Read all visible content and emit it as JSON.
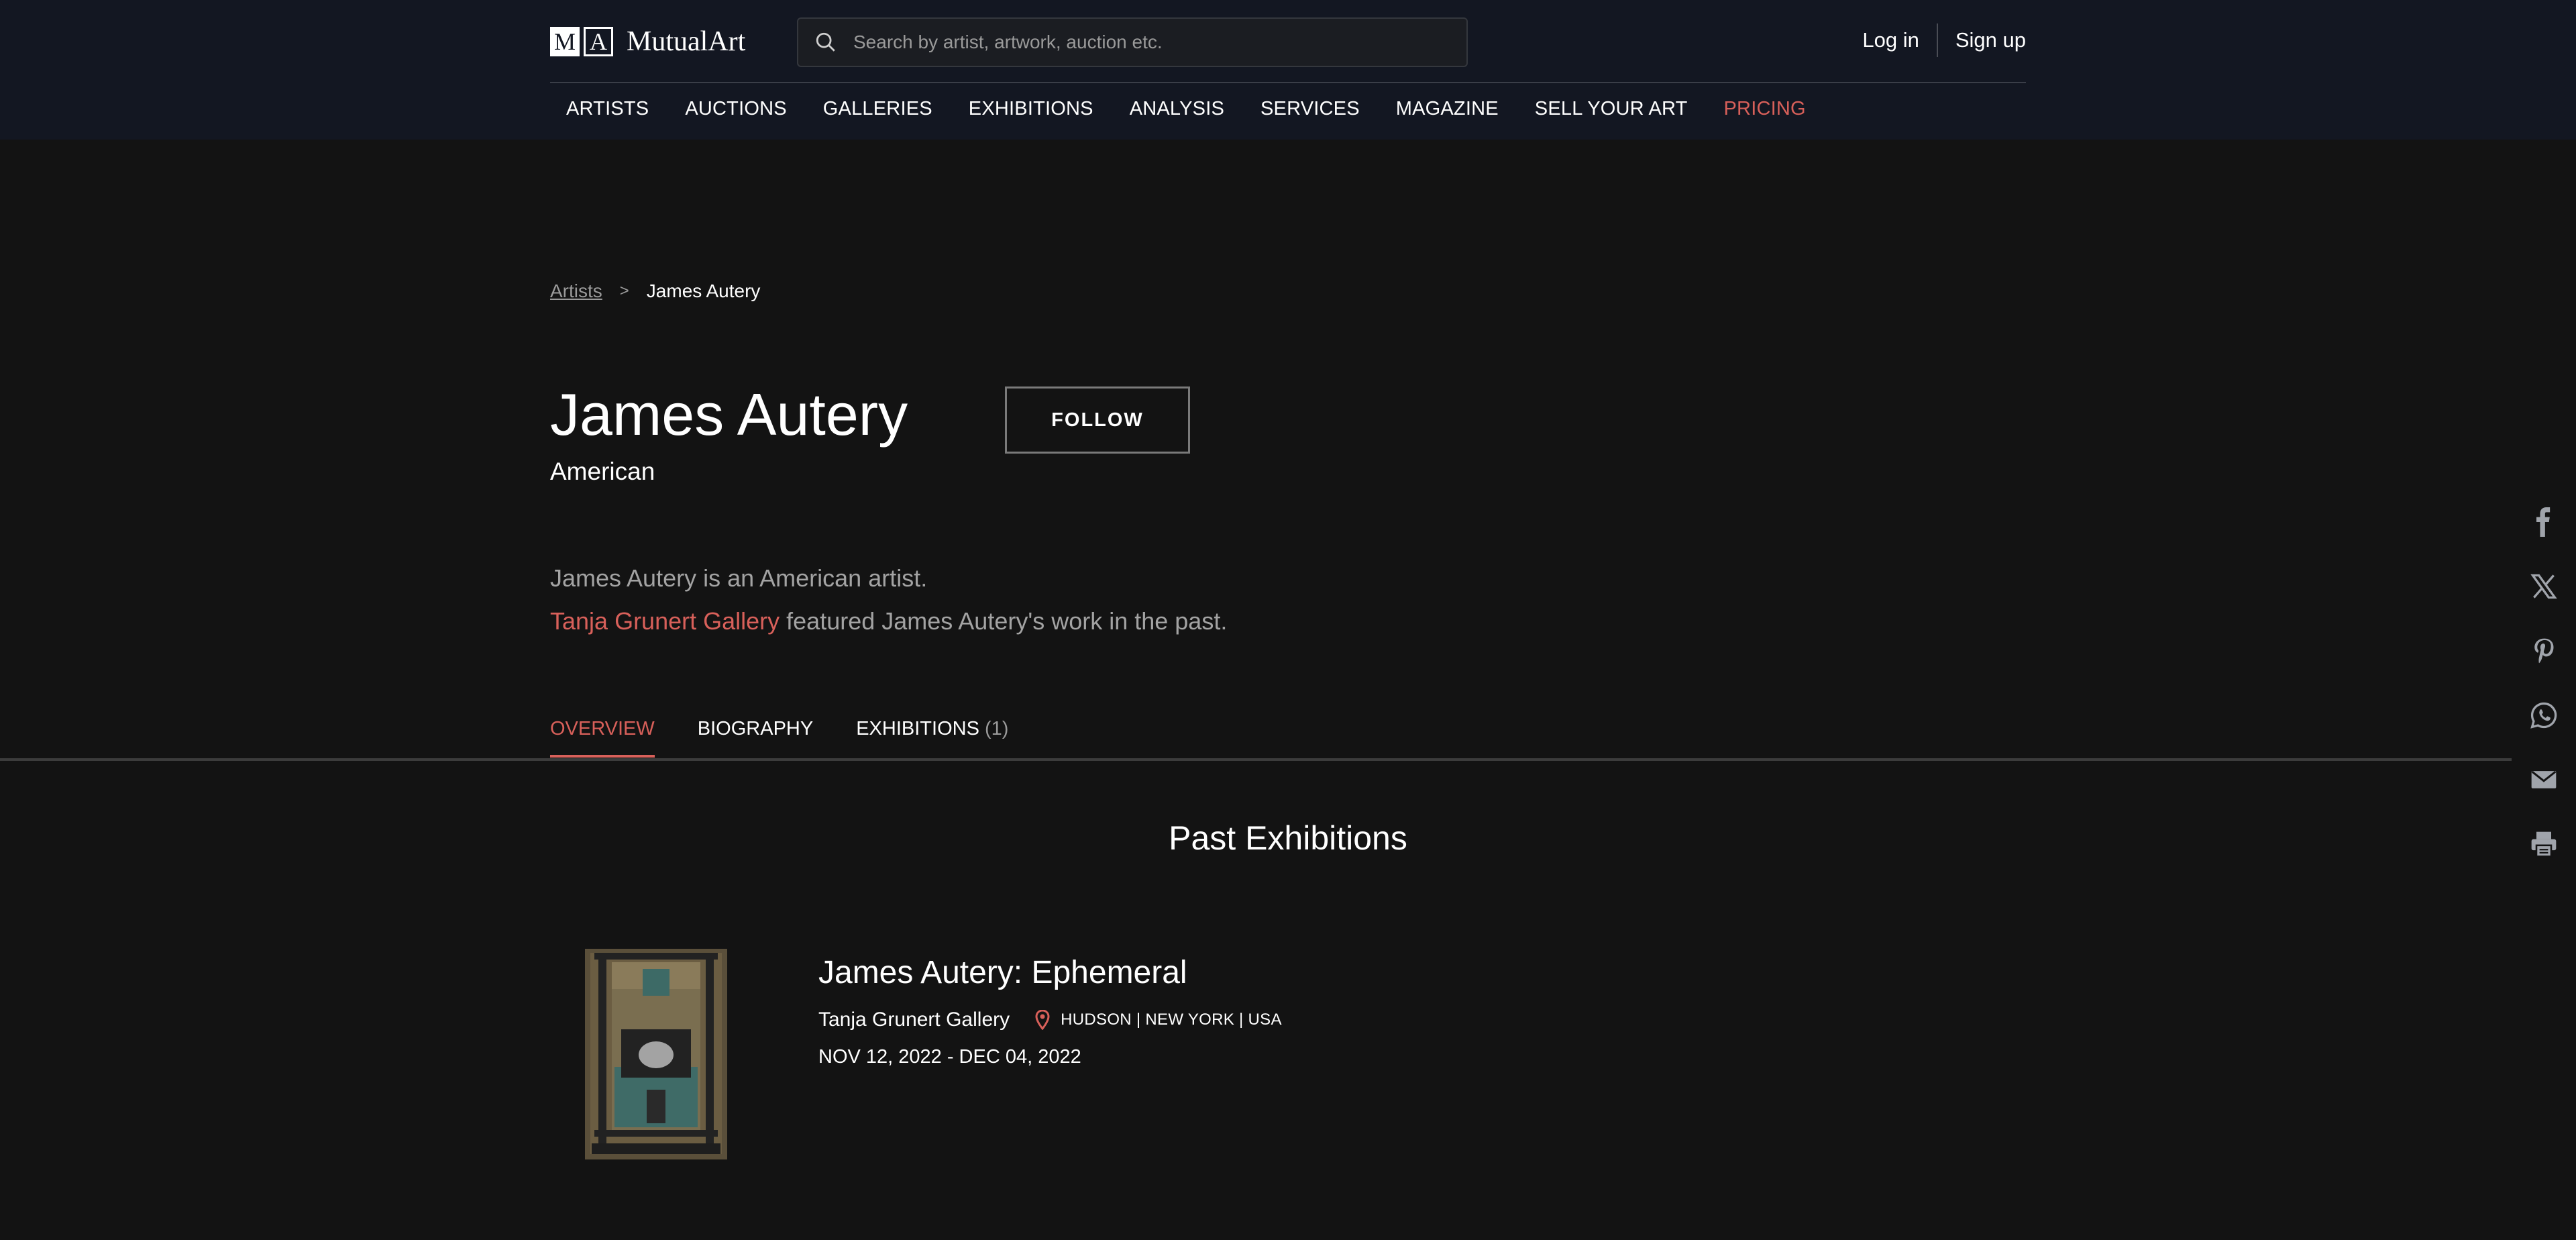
{
  "brand": {
    "logo_m": "M",
    "logo_a": "A",
    "name": "MutualArt"
  },
  "search": {
    "placeholder": "Search by artist, artwork, auction etc."
  },
  "auth": {
    "login": "Log in",
    "signup": "Sign up"
  },
  "nav": {
    "items": [
      "ARTISTS",
      "AUCTIONS",
      "GALLERIES",
      "EXHIBITIONS",
      "ANALYSIS",
      "SERVICES",
      "MAGAZINE",
      "SELL YOUR ART",
      "PRICING"
    ]
  },
  "breadcrumb": {
    "parent": "Artists",
    "separator": ">",
    "current": "James Autery"
  },
  "artist": {
    "name": "James Autery",
    "nationality": "American",
    "follow_label": "FOLLOW",
    "bio_line1": "James Autery is an American artist.",
    "bio_gallery": "Tanja Grunert Gallery",
    "bio_line2_rest": " featured James Autery's work in the past."
  },
  "tabs": {
    "overview": "OVERVIEW",
    "biography": "BIOGRAPHY",
    "exhibitions": "EXHIBITIONS",
    "exhibitions_count": "(1)"
  },
  "section": {
    "title": "Past Exhibitions"
  },
  "exhibitions": [
    {
      "title": "James Autery: Ephemeral",
      "gallery": "Tanja Grunert Gallery",
      "location": "HUDSON | NEW YORK | USA",
      "dates": "NOV 12, 2022 - DEC 04, 2022"
    }
  ],
  "share": [
    "facebook-icon",
    "x-icon",
    "pinterest-icon",
    "whatsapp-icon",
    "email-icon",
    "print-icon"
  ],
  "colors": {
    "accent": "#d8605a",
    "header_bg": "#131722",
    "page_bg": "#131313"
  }
}
